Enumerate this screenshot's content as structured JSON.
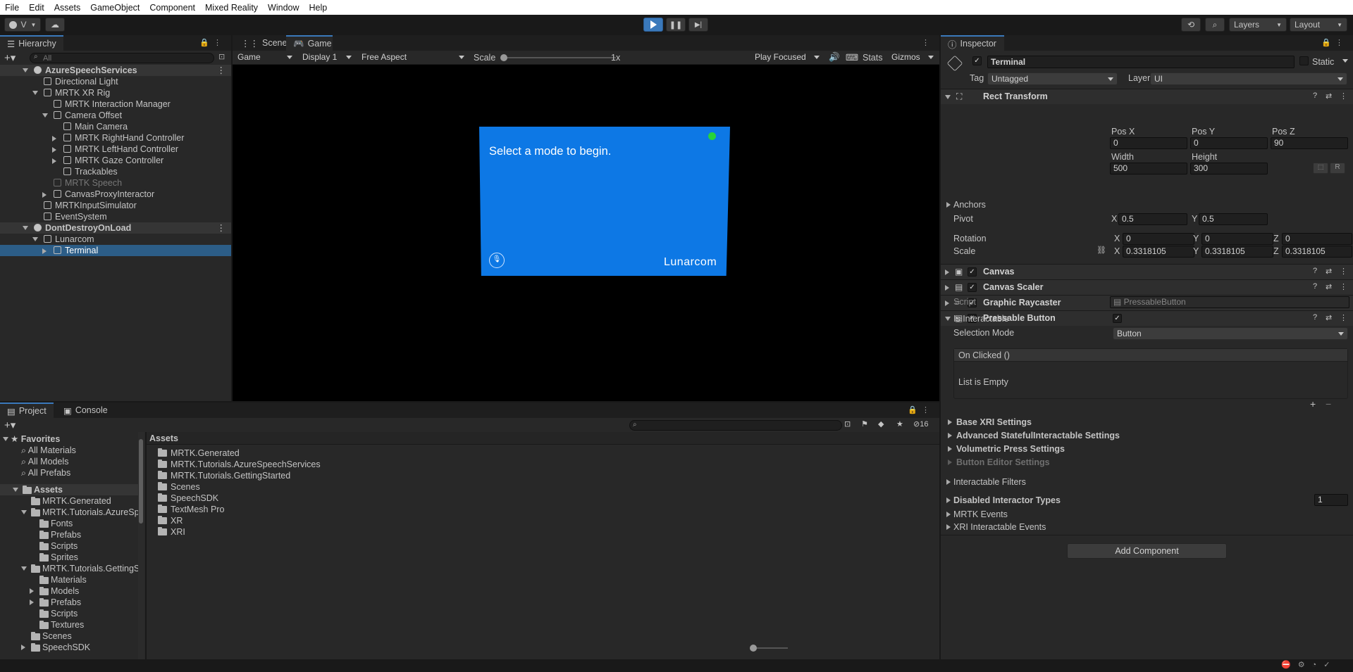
{
  "menu": [
    "File",
    "Edit",
    "Assets",
    "GameObject",
    "Component",
    "Mixed Reality",
    "Window",
    "Help"
  ],
  "toolbar": {
    "account": "V",
    "layers": "Layers",
    "layout": "Layout"
  },
  "hierarchy": {
    "tab": "Hierarchy",
    "search_placeholder": "All",
    "items": [
      {
        "label": "AzureSpeechServices",
        "indent": 0,
        "scene": true,
        "expanded": true
      },
      {
        "label": "Directional Light",
        "indent": 1
      },
      {
        "label": "MRTK XR Rig",
        "indent": 1,
        "expanded": true
      },
      {
        "label": "MRTK Interaction Manager",
        "indent": 2
      },
      {
        "label": "Camera Offset",
        "indent": 2,
        "expanded": true
      },
      {
        "label": "Main Camera",
        "indent": 3
      },
      {
        "label": "MRTK RightHand Controller",
        "indent": 3,
        "collapsed": true
      },
      {
        "label": "MRTK LeftHand Controller",
        "indent": 3,
        "collapsed": true
      },
      {
        "label": "MRTK Gaze Controller",
        "indent": 3,
        "collapsed": true
      },
      {
        "label": "Trackables",
        "indent": 3
      },
      {
        "label": "MRTK Speech",
        "indent": 2,
        "disabled": true
      },
      {
        "label": "CanvasProxyInteractor",
        "indent": 2,
        "collapsed": true
      },
      {
        "label": "MRTKInputSimulator",
        "indent": 1
      },
      {
        "label": "EventSystem",
        "indent": 1
      },
      {
        "label": "DontDestroyOnLoad",
        "indent": 0,
        "scene": true,
        "expanded": true
      },
      {
        "label": "Lunarcom",
        "indent": 1,
        "expanded": true
      },
      {
        "label": "Terminal",
        "indent": 2,
        "collapsed": true,
        "selected": true
      }
    ]
  },
  "game": {
    "tabs": [
      "Scene",
      "Game"
    ],
    "mode": "Game",
    "display": "Display 1",
    "aspect": "Free Aspect",
    "scale_label": "Scale",
    "scale_value": "1x",
    "play_focused": "Play Focused",
    "stats": "Stats",
    "gizmos": "Gizmos",
    "terminal_text": "Select a mode to begin.",
    "brand": "Lunarcom"
  },
  "project": {
    "tabs": [
      "Project",
      "Console"
    ],
    "hidden_count": "16",
    "favorites": {
      "title": "Favorites",
      "items": [
        "All Materials",
        "All Models",
        "All Prefabs"
      ]
    },
    "tree": [
      {
        "label": "Assets",
        "indent": 0,
        "bold": true
      },
      {
        "label": "MRTK.Generated",
        "indent": 1
      },
      {
        "label": "MRTK.Tutorials.AzureSpe",
        "indent": 1,
        "expanded": true
      },
      {
        "label": "Fonts",
        "indent": 2
      },
      {
        "label": "Prefabs",
        "indent": 2
      },
      {
        "label": "Scripts",
        "indent": 2
      },
      {
        "label": "Sprites",
        "indent": 2
      },
      {
        "label": "MRTK.Tutorials.GettingSta",
        "indent": 1,
        "expanded": true
      },
      {
        "label": "Materials",
        "indent": 2
      },
      {
        "label": "Models",
        "indent": 2,
        "collapsed": true
      },
      {
        "label": "Prefabs",
        "indent": 2,
        "collapsed": true
      },
      {
        "label": "Scripts",
        "indent": 2
      },
      {
        "label": "Textures",
        "indent": 2
      },
      {
        "label": "Scenes",
        "indent": 1
      },
      {
        "label": "SpeechSDK",
        "indent": 1,
        "collapsed": true
      }
    ],
    "breadcrumb": "Assets",
    "assets": [
      "MRTK.Generated",
      "MRTK.Tutorials.AzureSpeechServices",
      "MRTK.Tutorials.GettingStarted",
      "Scenes",
      "SpeechSDK",
      "TextMesh Pro",
      "XR",
      "XRI"
    ]
  },
  "inspector": {
    "tab": "Inspector",
    "object_name": "Terminal",
    "static_label": "Static",
    "tag_label": "Tag",
    "tag": "Untagged",
    "layer_label": "Layer",
    "layer": "UI",
    "rect": {
      "title": "Rect Transform",
      "pos_x_label": "Pos X",
      "pos_y_label": "Pos Y",
      "pos_z_label": "Pos Z",
      "pos_x": "0",
      "pos_y": "0",
      "pos_z": "90",
      "width_label": "Width",
      "height_label": "Height",
      "width": "500",
      "height": "300",
      "anchors": "Anchors",
      "pivot": "Pivot",
      "pivot_x": "0.5",
      "pivot_y": "0.5",
      "rotation": "Rotation",
      "rot_x": "0",
      "rot_y": "0",
      "rot_z": "0",
      "scale": "Scale",
      "scale_x": "0.3318105",
      "scale_y": "0.3318105",
      "scale_z": "0.3318105",
      "x": "X",
      "y": "Y",
      "z": "Z",
      "r_btn": "R"
    },
    "components": [
      "Canvas",
      "Canvas Scaler",
      "Graphic Raycaster",
      "Pressable Button"
    ],
    "button": {
      "script_label": "Script",
      "script": "PressableButton",
      "interactable_label": "Is Interactable",
      "selection_label": "Selection Mode",
      "selection": "Button",
      "onclick": "On Clicked ()",
      "empty": "List is Empty"
    },
    "sections": [
      "Base XRI Settings",
      "Advanced StatefulInteractable Settings",
      "Volumetric Press Settings",
      "Button Editor Settings"
    ],
    "filters": "Interactable Filters",
    "disabled_types": "Disabled Interactor Types",
    "disabled_count": "1",
    "mrtk_events": "MRTK Events",
    "xri_events": "XRI Interactable Events",
    "add_component": "Add Component"
  }
}
